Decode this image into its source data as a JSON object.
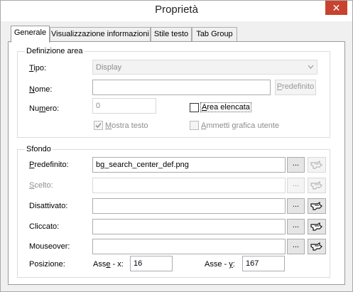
{
  "window": {
    "title": "Proprietà",
    "close_glyph": "✕"
  },
  "tabs": [
    {
      "label": "Generale",
      "active": true
    },
    {
      "label": "Visualizzazione informazioni",
      "active": false
    },
    {
      "label": "Stile testo",
      "active": false
    },
    {
      "label": "Tab Group",
      "active": false
    }
  ],
  "area": {
    "legend": "Definizione area",
    "tipo": {
      "label_u": "T",
      "label_rest": "ipo:",
      "value": "Display"
    },
    "nome": {
      "label_u": "N",
      "label_rest": "ome:",
      "value": "",
      "button": "Predefinito",
      "button_u": "P",
      "button_rest": "redefinito"
    },
    "numero": {
      "label_pre": "Nu",
      "label_u": "m",
      "label_rest": "ero:",
      "value": "0"
    },
    "area_elencata": {
      "label_u": "A",
      "label_rest": "rea elencata",
      "checked": false,
      "enabled": true
    },
    "mostra_testo": {
      "label_u": "M",
      "label_rest": "ostra testo",
      "checked": true,
      "enabled": false
    },
    "ammetti_grafica": {
      "label_u": "A",
      "label_rest": "mmetti grafica utente",
      "checked": false,
      "enabled": false
    }
  },
  "sfondo": {
    "legend": "Sfondo",
    "rows": [
      {
        "label_pre": "",
        "label_u": "P",
        "label_rest": "redefinito:",
        "value": "bg_search_center_def.png",
        "enabled": true,
        "browse": "...",
        "pick_enabled": false
      },
      {
        "label_pre": "",
        "label_u": "S",
        "label_rest": "celto:",
        "value": "",
        "enabled": false,
        "browse": "...",
        "pick_enabled": false
      },
      {
        "label_pre": "",
        "label_u": "",
        "label_rest": "Disattivato:",
        "value": "",
        "enabled": true,
        "browse": "...",
        "pick_enabled": true
      },
      {
        "label_pre": "",
        "label_u": "",
        "label_rest": "Cliccato:",
        "value": "",
        "enabled": true,
        "browse": "...",
        "pick_enabled": true
      },
      {
        "label_pre": "",
        "label_u": "",
        "label_rest": "Mouseover:",
        "value": "",
        "enabled": true,
        "browse": "...",
        "pick_enabled": true
      }
    ],
    "posizione": {
      "label": "Posizione:",
      "x_pre": "Ass",
      "x_u": "e",
      "x_rest": " - x:",
      "x_value": "16",
      "y_pre": "Asse - ",
      "y_u": "y",
      "y_rest": ":",
      "y_value": "167"
    }
  }
}
